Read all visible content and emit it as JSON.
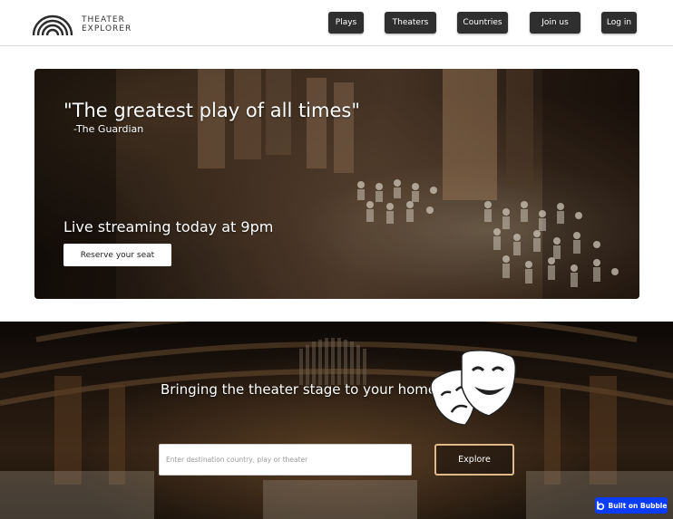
{
  "header": {
    "logo_line1": "THEATER",
    "logo_line2": "EXPLORER",
    "nav": [
      {
        "label": "Plays"
      },
      {
        "label": "Theaters"
      },
      {
        "label": "Countries"
      },
      {
        "label": "Join us"
      },
      {
        "label": "Log in"
      }
    ]
  },
  "hero": {
    "quote": "\"The greatest play of all times\"",
    "source": "-The Guardian",
    "stream_text": "Live streaming today at 9pm",
    "reserve_label": "Reserve your seat"
  },
  "discover": {
    "tagline": "Bringing the theater stage to your home!",
    "search_placeholder": "Enter destination country, play or theater",
    "search_value": "",
    "explore_label": "Explore"
  },
  "badge": {
    "label": "Built on Bubble"
  },
  "colors": {
    "nav_bg": "#2f2f2f",
    "explore_border": "#e0b98a",
    "badge_bg": "#0a3cff"
  },
  "icons": {
    "logo": "rainbow-arches-icon",
    "masks": "theater-masks-icon",
    "bubble": "bubble-logo-icon"
  }
}
